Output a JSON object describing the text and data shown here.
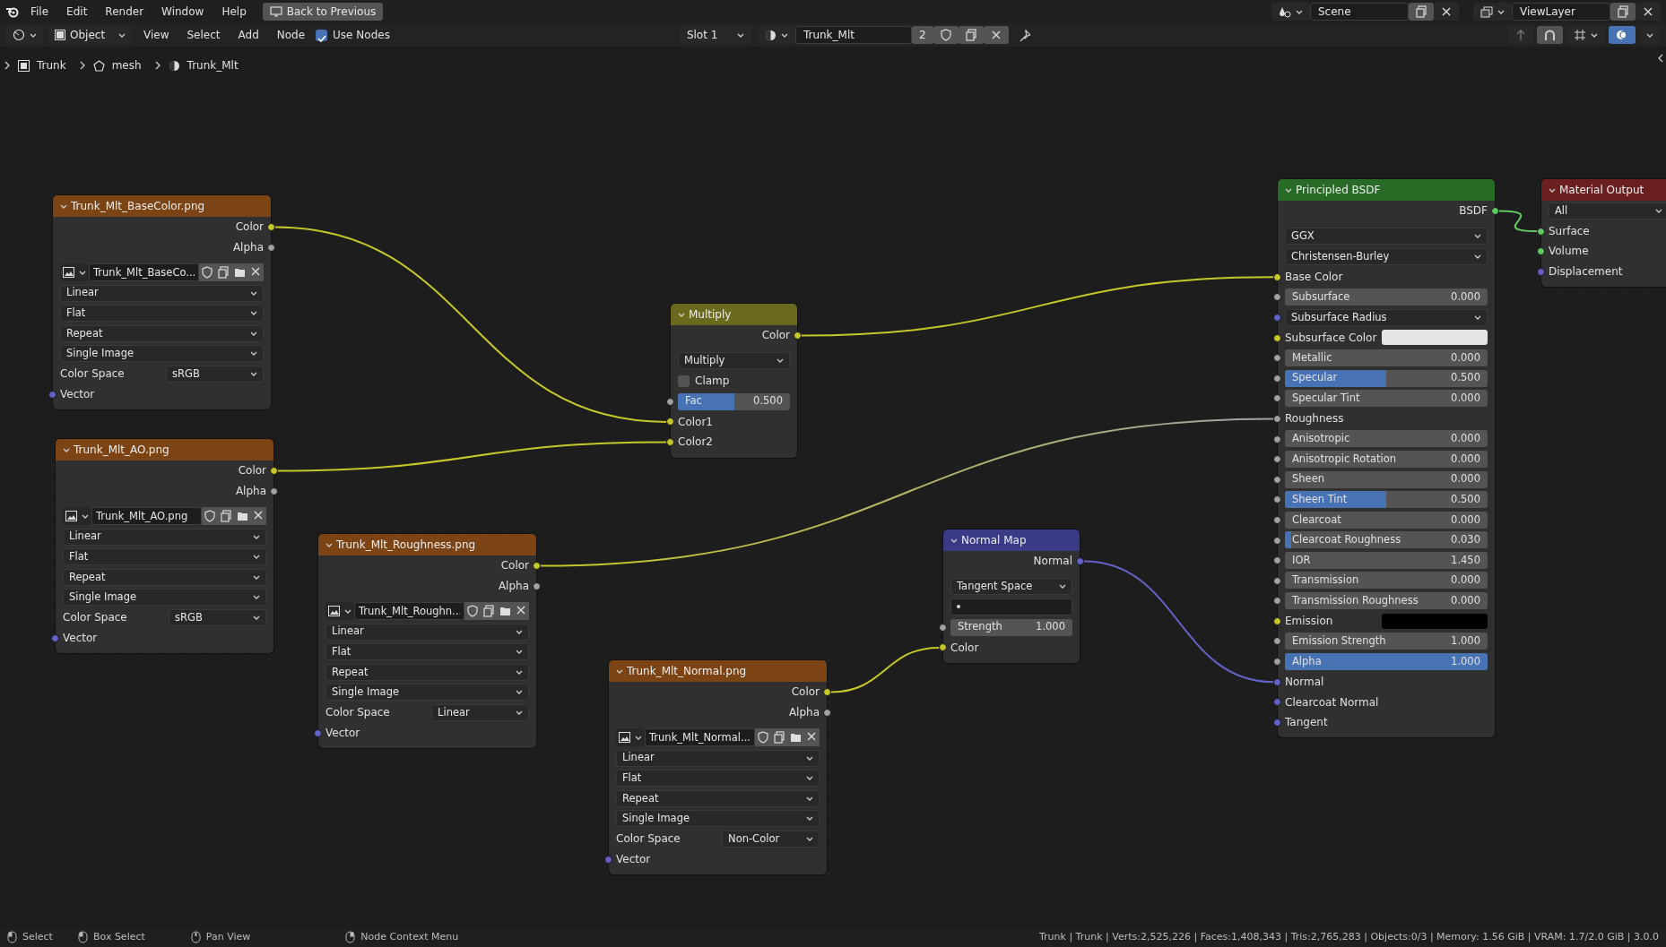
{
  "menu_bar": {
    "menus": [
      "File",
      "Edit",
      "Render",
      "Window",
      "Help"
    ],
    "back_button": "Back to Previous",
    "scene": "Scene",
    "view_layer": "ViewLayer"
  },
  "header": {
    "mode": "Object",
    "menus": [
      "View",
      "Select",
      "Add",
      "Node"
    ],
    "use_nodes": {
      "label": "Use Nodes",
      "checked": true
    },
    "slot": "Slot 1",
    "material": "Trunk_Mlt",
    "users": "2"
  },
  "breadcrumbs": [
    "Trunk",
    "mesh",
    "Trunk_Mlt"
  ],
  "nodes": [
    {
      "kind": "shader",
      "title": "Principled BSDF",
      "rows": [
        {
          "kind": "output",
          "label": "BSDF",
          "socket": {
            "color": "#63c763"
          }
        },
        {
          "kind": "dropdown",
          "value": "GGX"
        },
        {
          "kind": "dropdown",
          "value": "Christensen-Burley"
        },
        {
          "kind": "input",
          "label": "Base Color",
          "socket": {
            "color": "#c7c729"
          }
        },
        {
          "kind": "slider",
          "label": "Subsurface",
          "value": "0.000",
          "socket": {
            "color": "#a1a1a1"
          }
        },
        {
          "kind": "dropdown",
          "value": "Subsurface Radius",
          "socket": {
            "color": "#6363c7"
          }
        },
        {
          "kind": "swatch",
          "label": "Subsurface Color",
          "color": "#e6e6e6",
          "socket": {
            "color": "#c7c729"
          }
        },
        {
          "kind": "slider",
          "label": "Metallic",
          "value": "0.000",
          "socket": {
            "color": "#a1a1a1"
          }
        },
        {
          "kind": "slider",
          "label": "Specular",
          "value": "0.500",
          "level": 0.5,
          "socket": {
            "color": "#a1a1a1"
          }
        },
        {
          "kind": "slider",
          "label": "Specular Tint",
          "value": "0.000",
          "socket": {
            "color": "#a1a1a1"
          }
        },
        {
          "kind": "input",
          "label": "Roughness",
          "socket": {
            "color": "#a1a1a1"
          }
        },
        {
          "kind": "slider",
          "label": "Anisotropic",
          "value": "0.000",
          "socket": {
            "color": "#a1a1a1"
          }
        },
        {
          "kind": "slider",
          "label": "Anisotropic Rotation",
          "value": "0.000",
          "socket": {
            "color": "#a1a1a1"
          }
        },
        {
          "kind": "slider",
          "label": "Sheen",
          "value": "0.000",
          "socket": {
            "color": "#a1a1a1"
          }
        },
        {
          "kind": "slider",
          "label": "Sheen Tint",
          "value": "0.500",
          "level": 0.5,
          "socket": {
            "color": "#a1a1a1"
          }
        },
        {
          "kind": "slider",
          "label": "Clearcoat",
          "value": "0.000",
          "socket": {
            "color": "#a1a1a1"
          }
        },
        {
          "kind": "slider",
          "label": "Clearcoat Roughness",
          "value": "0.030",
          "level": 0.03,
          "socket": {
            "color": "#a1a1a1"
          }
        },
        {
          "kind": "slider",
          "label": "IOR",
          "value": "1.450",
          "socket": {
            "color": "#a1a1a1"
          }
        },
        {
          "kind": "slider",
          "label": "Transmission",
          "value": "0.000",
          "socket": {
            "color": "#a1a1a1"
          }
        },
        {
          "kind": "slider",
          "label": "Transmission Roughness",
          "value": "0.000",
          "socket": {
            "color": "#a1a1a1"
          }
        },
        {
          "kind": "swatch",
          "label": "Emission",
          "color": "#000000",
          "socket": {
            "color": "#c7c729"
          }
        },
        {
          "kind": "slider",
          "label": "Emission Strength",
          "value": "1.000",
          "socket": {
            "color": "#a1a1a1"
          }
        },
        {
          "kind": "slider",
          "label": "Alpha",
          "value": "1.000",
          "level": 1,
          "socket": {
            "color": "#a1a1a1"
          }
        },
        {
          "kind": "input",
          "label": "Normal",
          "socket": {
            "color": "#6363c7"
          }
        },
        {
          "kind": "input",
          "label": "Clearcoat Normal",
          "socket": {
            "color": "#6363c7"
          }
        },
        {
          "kind": "input",
          "label": "Tangent",
          "socket": {
            "color": "#6363c7"
          }
        }
      ]
    },
    {
      "kind": "output",
      "title": "Material Output",
      "rows": [
        {
          "kind": "dropdown",
          "value": "All"
        },
        {
          "kind": "input",
          "label": "Surface",
          "socket": {
            "color": "#63c763"
          }
        },
        {
          "kind": "input",
          "label": "Volume",
          "socket": {
            "color": "#63c763"
          }
        },
        {
          "kind": "input",
          "label": "Displacement",
          "socket": {
            "color": "#6363c7"
          }
        }
      ]
    },
    {
      "kind": "texture",
      "title": "Trunk_Mlt_BaseColor.png",
      "rows": [
        {
          "kind": "output",
          "label": "Color",
          "socket": {
            "color": "#c7c729"
          }
        },
        {
          "kind": "output",
          "label": "Alpha",
          "socket": {
            "color": "#a1a1a1"
          }
        },
        {
          "kind": "image",
          "value": "Trunk_Mlt_BaseCo..."
        },
        {
          "kind": "dropdown",
          "value": "Linear"
        },
        {
          "kind": "dropdown",
          "value": "Flat"
        },
        {
          "kind": "dropdown",
          "value": "Repeat"
        },
        {
          "kind": "dropdown",
          "value": "Single Image"
        },
        {
          "kind": "labeled-dropdown",
          "label": "Color Space",
          "value": "sRGB"
        },
        {
          "kind": "input",
          "label": "Vector",
          "socket": {
            "color": "#6363c7"
          }
        }
      ]
    },
    {
      "kind": "color",
      "title": "Multiply",
      "rows": [
        {
          "kind": "output",
          "label": "Color",
          "socket": {
            "color": "#c7c729"
          }
        },
        {
          "kind": "dropdown",
          "value": "Multiply"
        },
        {
          "kind": "checkbox",
          "label": "Clamp",
          "checked": false
        },
        {
          "kind": "slider",
          "label": "Fac",
          "value": "0.500",
          "level": 0.5,
          "socket": {
            "color": "#a1a1a1"
          }
        },
        {
          "kind": "input",
          "label": "Color1",
          "socket": {
            "color": "#c7c729"
          }
        },
        {
          "kind": "input",
          "label": "Color2",
          "socket": {
            "color": "#c7c729"
          }
        }
      ]
    },
    {
      "kind": "texture",
      "title": "Trunk_Mlt_AO.png",
      "rows": [
        {
          "kind": "output",
          "label": "Color",
          "socket": {
            "color": "#c7c729"
          }
        },
        {
          "kind": "output",
          "label": "Alpha",
          "socket": {
            "color": "#a1a1a1"
          }
        },
        {
          "kind": "image",
          "value": "Trunk_Mlt_AO.png"
        },
        {
          "kind": "dropdown",
          "value": "Linear"
        },
        {
          "kind": "dropdown",
          "value": "Flat"
        },
        {
          "kind": "dropdown",
          "value": "Repeat"
        },
        {
          "kind": "dropdown",
          "value": "Single Image"
        },
        {
          "kind": "labeled-dropdown",
          "label": "Color Space",
          "value": "sRGB"
        },
        {
          "kind": "input",
          "label": "Vector",
          "socket": {
            "color": "#6363c7"
          }
        }
      ]
    },
    {
      "kind": "texture",
      "title": "Trunk_Mlt_Roughness.png",
      "rows": [
        {
          "kind": "output",
          "label": "Color",
          "socket": {
            "color": "#c7c729"
          }
        },
        {
          "kind": "output",
          "label": "Alpha",
          "socket": {
            "color": "#a1a1a1"
          }
        },
        {
          "kind": "image",
          "value": "Trunk_Mlt_Roughn..."
        },
        {
          "kind": "dropdown",
          "value": "Linear"
        },
        {
          "kind": "dropdown",
          "value": "Flat"
        },
        {
          "kind": "dropdown",
          "value": "Repeat"
        },
        {
          "kind": "dropdown",
          "value": "Single Image"
        },
        {
          "kind": "labeled-dropdown",
          "label": "Color Space",
          "value": "Linear"
        },
        {
          "kind": "input",
          "label": "Vector",
          "socket": {
            "color": "#6363c7"
          }
        }
      ]
    },
    {
      "kind": "vector",
      "title": "Normal Map",
      "rows": [
        {
          "kind": "output",
          "label": "Normal",
          "socket": {
            "color": "#6363c7"
          }
        },
        {
          "kind": "dropdown",
          "value": "Tangent Space"
        },
        {
          "kind": "uv-field"
        },
        {
          "kind": "slider",
          "label": "Strength",
          "value": "1.000",
          "socket": {
            "color": "#a1a1a1"
          }
        },
        {
          "kind": "input",
          "label": "Color",
          "socket": {
            "color": "#c7c729"
          }
        }
      ]
    },
    {
      "kind": "texture",
      "title": "Trunk_Mlt_Normal.png",
      "rows": [
        {
          "kind": "output",
          "label": "Color",
          "socket": {
            "color": "#c7c729"
          }
        },
        {
          "kind": "output",
          "label": "Alpha",
          "socket": {
            "color": "#a1a1a1"
          }
        },
        {
          "kind": "image",
          "value": "Trunk_Mlt_Normal..."
        },
        {
          "kind": "dropdown",
          "value": "Linear"
        },
        {
          "kind": "dropdown",
          "value": "Flat"
        },
        {
          "kind": "dropdown",
          "value": "Repeat"
        },
        {
          "kind": "dropdown",
          "value": "Single Image"
        },
        {
          "kind": "labeled-dropdown",
          "label": "Color Space",
          "value": "Non-Color"
        },
        {
          "kind": "input",
          "label": "Vector",
          "socket": {
            "color": "#6363c7"
          }
        }
      ]
    }
  ],
  "status_bar": {
    "hints": [
      "Select",
      "Box Select",
      "Pan View",
      "Node Context Menu"
    ],
    "stats": "Trunk | Trunk | Verts:2,525,226 | Faces:1,408,343 | Tris:2,765,283 | Objects:0/3 | Memory: 1.56 GiB | VRAM: 1.7/2.0 GiB | 3.0.0"
  }
}
